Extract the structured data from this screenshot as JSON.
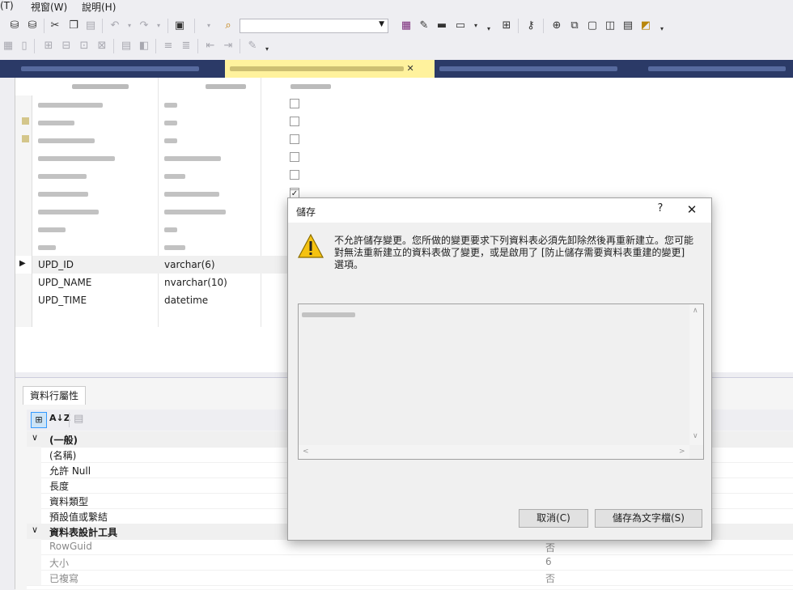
{
  "menu": {
    "items": [
      "(T)",
      "視窗(W)",
      "說明(H)"
    ]
  },
  "tabs": {
    "left_close": "✕",
    "active_close": "✕"
  },
  "grid": {
    "rows": [
      {
        "name": "UPD_ID",
        "type": "varchar(6)"
      },
      {
        "name": "UPD_NAME",
        "type": "nvarchar(10)"
      },
      {
        "name": "UPD_TIME",
        "type": "datetime"
      }
    ],
    "current_row_marker": "▶"
  },
  "properties": {
    "tab_label": "資料行屬性",
    "sort_button": "A↓Z",
    "rows": [
      {
        "name": "(一般)",
        "value": "",
        "category": true
      },
      {
        "name": "(名稱)",
        "value": ""
      },
      {
        "name": "允許 Null",
        "value": ""
      },
      {
        "name": "長度",
        "value": ""
      },
      {
        "name": "資料類型",
        "value": ""
      },
      {
        "name": "預設值或繫結",
        "value": ""
      },
      {
        "name": "資料表設計工具",
        "value": "",
        "category": true
      },
      {
        "name": "RowGuid",
        "value": "否",
        "gray": true
      },
      {
        "name": "大小",
        "value": "6",
        "gray": true
      },
      {
        "name": "已複寫",
        "value": "否",
        "gray": true
      }
    ]
  },
  "dialog": {
    "title": "儲存",
    "help": "?",
    "close": "✕",
    "message": "不允許儲存變更。您所做的變更要求下列資料表必須先卸除然後再重新建立。您可能對無法重新建立的資料表做了變更，或是啟用了 [防止儲存需要資料表重建的變更] 選項。",
    "cancel_label": "取消(C)",
    "save_text_label": "儲存為文字檔(S)"
  },
  "colors": {
    "accent": "#2b3a67",
    "active_tab": "#fff29d",
    "warning": "#f5c211"
  }
}
